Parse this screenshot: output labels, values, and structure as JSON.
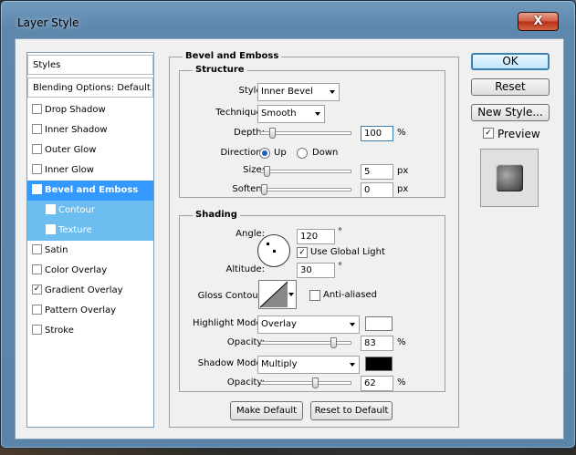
{
  "window": {
    "title": "Layer Style",
    "close": "X"
  },
  "sidebar": {
    "styles": "Styles",
    "blending": "Blending Options: Default",
    "items": [
      {
        "label": "Drop Shadow",
        "checked": false
      },
      {
        "label": "Inner Shadow",
        "checked": false
      },
      {
        "label": "Outer Glow",
        "checked": false
      },
      {
        "label": "Inner Glow",
        "checked": false
      },
      {
        "label": "Bevel and Emboss",
        "checked": true
      },
      {
        "label": "Contour",
        "checked": false
      },
      {
        "label": "Texture",
        "checked": true
      },
      {
        "label": "Satin",
        "checked": false
      },
      {
        "label": "Color Overlay",
        "checked": false
      },
      {
        "label": "Gradient Overlay",
        "checked": true
      },
      {
        "label": "Pattern Overlay",
        "checked": false
      },
      {
        "label": "Stroke",
        "checked": false
      }
    ]
  },
  "bevel": {
    "title": "Bevel and Emboss",
    "structure": {
      "title": "Structure",
      "style_label": "Style:",
      "style_value": "Inner Bevel",
      "technique_label": "Technique:",
      "technique_value": "Smooth",
      "depth_label": "Depth:",
      "depth_value": "100",
      "depth_unit": "%",
      "depth_slider": 0.1,
      "direction_label": "Direction:",
      "up": "Up",
      "down": "Down",
      "size_label": "Size:",
      "size_value": "5",
      "size_unit": "px",
      "size_slider": 0.03,
      "soften_label": "Soften:",
      "soften_value": "0",
      "soften_unit": "px",
      "soften_slider": 0.0
    },
    "shading": {
      "title": "Shading",
      "angle_label": "Angle:",
      "angle_value": "120",
      "angle_unit": "°",
      "global_light": "Use Global Light",
      "altitude_label": "Altitude:",
      "altitude_value": "30",
      "altitude_unit": "°",
      "gloss_label": "Gloss Contour:",
      "anti_aliased": "Anti-aliased",
      "highlight_label": "Highlight Mode:",
      "highlight_value": "Overlay",
      "highlight_color": "#ffffff",
      "hopacity_label": "Opacity:",
      "hopacity_value": "83",
      "hopacity_unit": "%",
      "hopacity_slider": 0.83,
      "shadow_label": "Shadow Mode:",
      "shadow_value": "Multiply",
      "shadow_color": "#000000",
      "sopacity_label": "Opacity:",
      "sopacity_value": "62",
      "sopacity_unit": "%",
      "sopacity_slider": 0.62
    },
    "make_default": "Make Default",
    "reset_default": "Reset to Default"
  },
  "actions": {
    "ok": "OK",
    "reset": "Reset",
    "new_style": "New Style...",
    "preview": "Preview"
  }
}
